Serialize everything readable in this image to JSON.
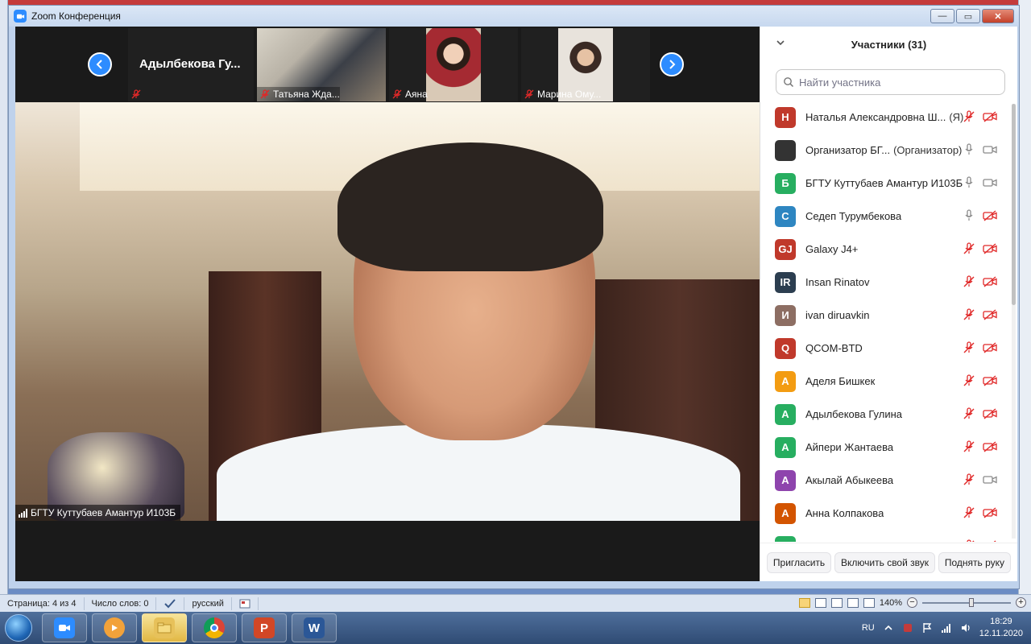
{
  "window": {
    "title": "Zoom Конференция",
    "close": "✕",
    "minimize": "—",
    "maximize": "▭"
  },
  "strip": {
    "tiles": [
      {
        "name": "Адылбекова  Гу..."
      },
      {
        "name": "Татьяна Жда..."
      },
      {
        "name": "Аяна"
      },
      {
        "name": "Марина Ому..."
      }
    ]
  },
  "main_video": {
    "name": "БГТУ Куттубаев Амантур И103Б"
  },
  "panel": {
    "title": "Участники (31)",
    "search_placeholder": "Найти участника",
    "participants": [
      {
        "initial": "Н",
        "color": "#c0392b",
        "name": "Наталья Александровна Ш...",
        "note": "(Я)",
        "mic": "muted",
        "cam": "off"
      },
      {
        "initial": "",
        "color": "#333333",
        "name": "Организатор БГ...",
        "note": "(Организатор)",
        "mic": "on",
        "cam": "on"
      },
      {
        "initial": "Б",
        "color": "#27ae60",
        "name": "БГТУ Куттубаев Амантур И103Б",
        "note": "",
        "mic": "on",
        "cam": "on"
      },
      {
        "initial": "С",
        "color": "#2e86c1",
        "name": "Седеп Турумбекова",
        "note": "",
        "mic": "on",
        "cam": "off"
      },
      {
        "initial": "GJ",
        "color": "#c0392b",
        "name": "Galaxy J4+",
        "note": "",
        "mic": "muted",
        "cam": "off"
      },
      {
        "initial": "IR",
        "color": "#2c3e50",
        "name": "Insan Rinatov",
        "note": "",
        "mic": "muted",
        "cam": "off"
      },
      {
        "initial": "И",
        "color": "#8d6e63",
        "name": "ivan diruavkin",
        "note": "",
        "mic": "muted",
        "cam": "off"
      },
      {
        "initial": "Q",
        "color": "#c0392b",
        "name": "QCOM-BTD",
        "note": "",
        "mic": "muted",
        "cam": "off"
      },
      {
        "initial": "А",
        "color": "#f39c12",
        "name": "Аделя Бишкек",
        "note": "",
        "mic": "muted",
        "cam": "off"
      },
      {
        "initial": "А",
        "color": "#27ae60",
        "name": "Адылбекова Гулина",
        "note": "",
        "mic": "muted",
        "cam": "off"
      },
      {
        "initial": "А",
        "color": "#27ae60",
        "name": "Айпери Жантаева",
        "note": "",
        "mic": "muted",
        "cam": "off"
      },
      {
        "initial": "А",
        "color": "#8e44ad",
        "name": "Акылай Абыкеева",
        "note": "",
        "mic": "muted",
        "cam": "on"
      },
      {
        "initial": "А",
        "color": "#d35400",
        "name": "Анна Колпакова",
        "note": "",
        "mic": "muted",
        "cam": "off"
      },
      {
        "initial": "",
        "color": "#27ae60",
        "name": "",
        "note": "",
        "mic": "muted",
        "cam": "off"
      }
    ],
    "buttons": {
      "invite": "Пригласить",
      "unmute": "Включить свой звук",
      "raise_hand": "Поднять руку"
    }
  },
  "statusbar": {
    "page": "Страница: 4 из 4",
    "words": "Число слов: 0",
    "language": "русский",
    "zoom": "140%"
  },
  "taskbar": {
    "lang": "RU",
    "time": "18:29",
    "date": "12.11.2020",
    "apps": [
      {
        "icon": "zoom-icon",
        "label": ""
      },
      {
        "icon": "media-player-icon",
        "label": ""
      },
      {
        "icon": "explorer-icon",
        "label": ""
      },
      {
        "icon": "chrome-icon",
        "label": ""
      },
      {
        "icon": "powerpoint-icon",
        "label": "P"
      },
      {
        "icon": "word-icon",
        "label": "W"
      }
    ]
  },
  "colors": {
    "zoom_blue": "#2d8cff",
    "muted_red": "#e02828"
  }
}
